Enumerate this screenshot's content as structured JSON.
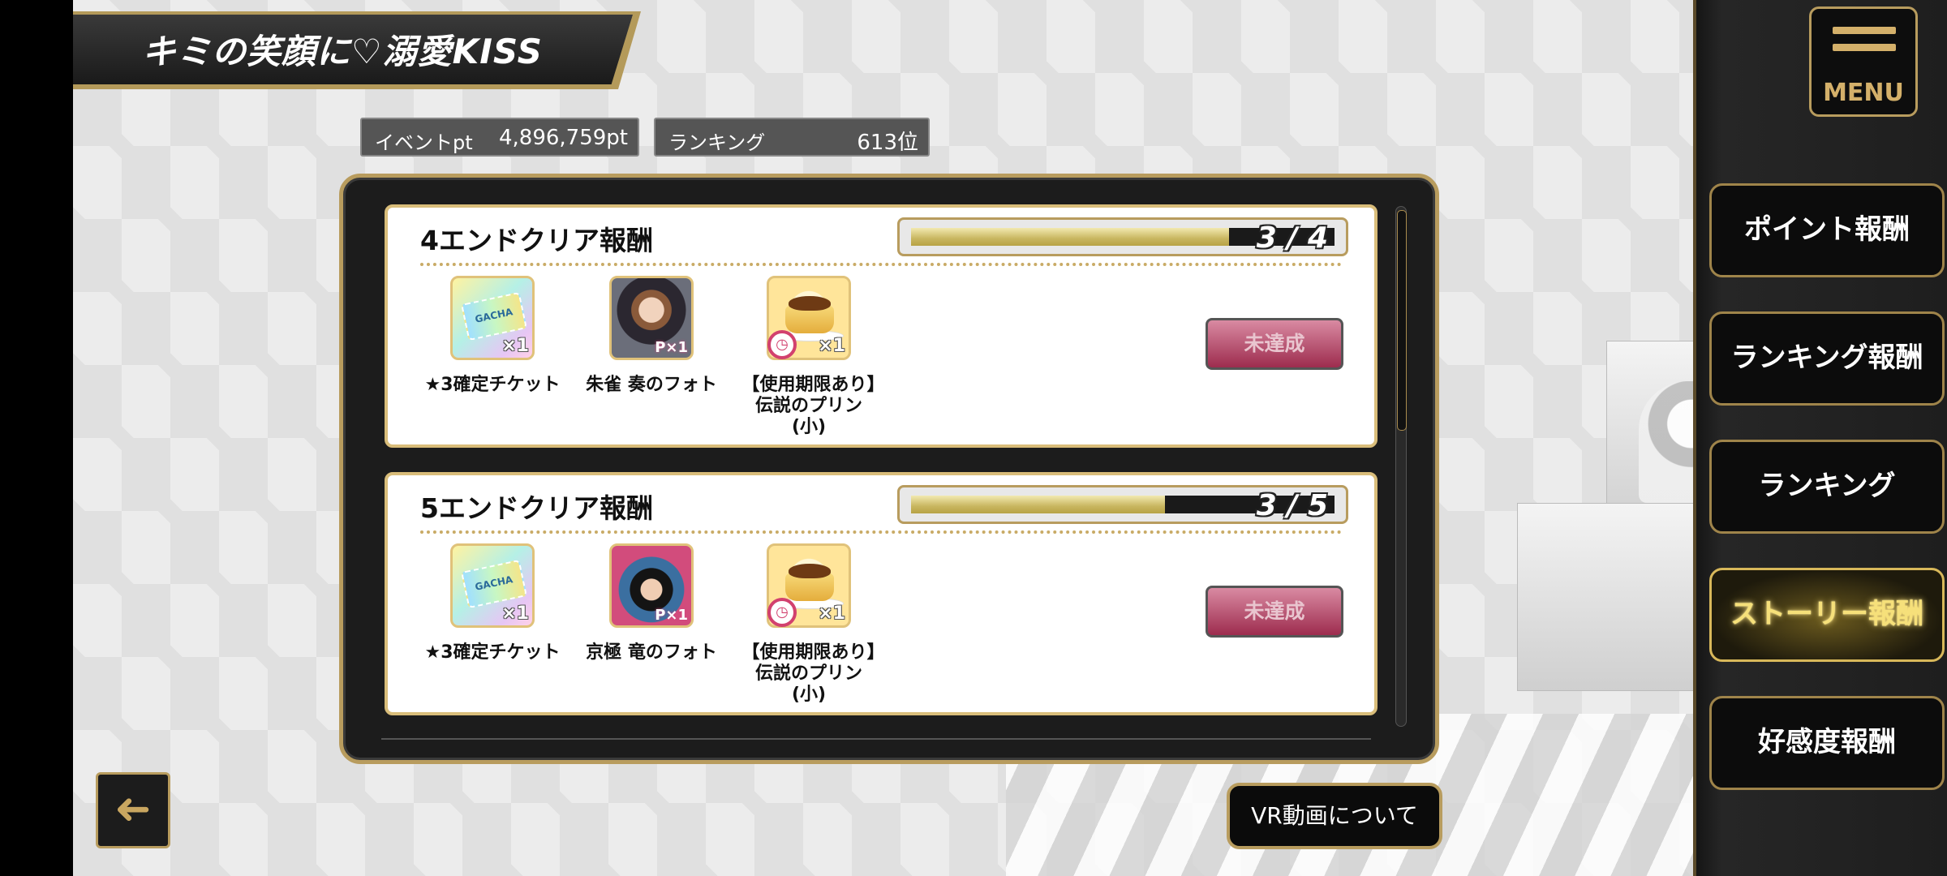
{
  "event_title": "キミの笑顔に♡溺愛KISS",
  "stats": {
    "event_pt_label": "イベントpt",
    "event_pt_value": "4,896,759pt",
    "ranking_label": "ランキング",
    "ranking_value": "613位"
  },
  "rewards": [
    {
      "title": "4エンドクリア報酬",
      "progress_text": "3 / 4",
      "progress_fraction": 0.75,
      "status_label": "未達成",
      "items": [
        {
          "icon": "gacha-ticket-icon",
          "qty": "×1",
          "name": "★3確定チケット"
        },
        {
          "icon": "photo-suzaku-icon",
          "qty": "P×1",
          "name": "朱雀 奏のフォト"
        },
        {
          "icon": "pudding-icon",
          "qty": "×1",
          "name": "【使用期限あり】伝説のプリン(小)"
        }
      ]
    },
    {
      "title": "5エンドクリア報酬",
      "progress_text": "3 / 5",
      "progress_fraction": 0.6,
      "status_label": "未達成",
      "items": [
        {
          "icon": "gacha-ticket-icon",
          "qty": "×1",
          "name": "★3確定チケット"
        },
        {
          "icon": "photo-kyogoku-icon",
          "qty": "P×1",
          "name": "京極 竜のフォト"
        },
        {
          "icon": "pudding-icon",
          "qty": "×1",
          "name": "【使用期限あり】伝説のプリン(小)"
        }
      ]
    }
  ],
  "ticket_text": "GACHA",
  "buttons": {
    "back_symbol": "➜",
    "vr_label": "VR動画について",
    "menu_label": "MENU"
  },
  "sidebar": [
    {
      "label": "ポイント報酬",
      "active": false
    },
    {
      "label": "ランキング報酬",
      "active": false
    },
    {
      "label": "ランキング",
      "active": false
    },
    {
      "label": "ストーリー報酬",
      "active": true
    },
    {
      "label": "好感度報酬",
      "active": false
    }
  ],
  "colors": {
    "gold": "#b89c5e",
    "active_text": "#f6e07a",
    "status_button": "#9d2c4e"
  }
}
